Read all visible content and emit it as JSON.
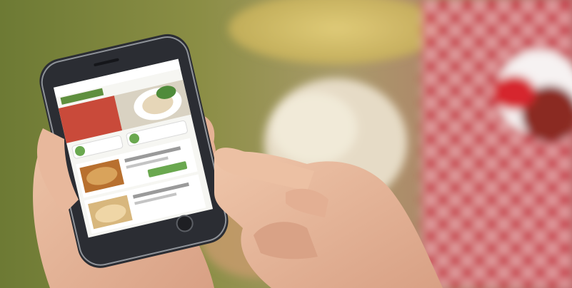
{
  "scene": {
    "description_tag": "",
    "colors": {
      "background_green": "#6f7f3a",
      "tablecloth_red": "#c8283a",
      "phone_body": "#2b2d33",
      "app_green": "#6aa84f",
      "skin": "#e7b79a"
    }
  },
  "app": {
    "brand_label": "",
    "status_time": ""
  }
}
